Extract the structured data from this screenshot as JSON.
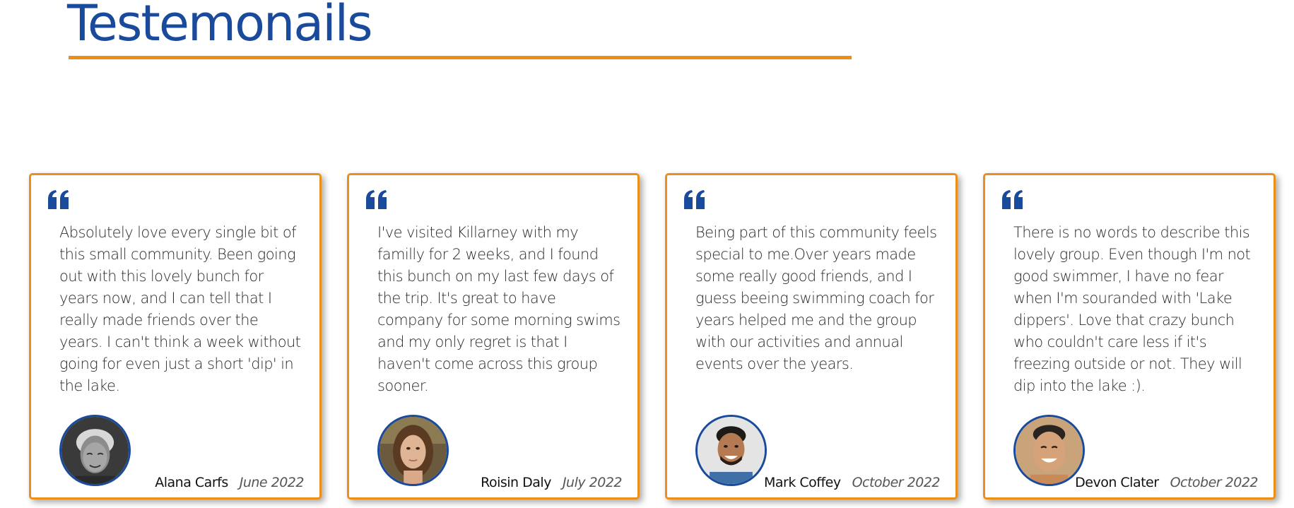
{
  "section": {
    "title": "Testemonails",
    "accent_color": "#e98f1a",
    "title_color": "#1a4a9c"
  },
  "testimonials": [
    {
      "text": "Absolutely love every single bit of this small community. Been going out with this lovely bunch for years now, and I can tell that I really made friends over the years. I can't think a week without going for even just a short 'dip' in the lake.",
      "author": "Alana Carfs",
      "date": "June 2022",
      "icon": "quote-icon",
      "avatar": "avatar-elderly-woman"
    },
    {
      "text": "I've visited Killarney with my familly for 2 weeks, and I found this bunch on my last few days of the trip. It's great to have company for some morning swims and my only regret is that I haven't come across this group sooner.",
      "author": "Roisin Daly",
      "date": "July 2022",
      "icon": "quote-icon",
      "avatar": "avatar-young-woman"
    },
    {
      "text": "Being part of this community feels special to me.Over years made some really good friends, and I guess beeing swimming coach for years helped me and the group with our activities and annual events over the years.",
      "author": "Mark Coffey",
      "date": "October 2022",
      "icon": "quote-icon",
      "avatar": "avatar-smiling-man"
    },
    {
      "text": "There is no words to describe this lovely group. Even though I'm not good swimmer, I have no fear when I'm souranded with 'Lake dippers'. Love that crazy bunch who couldn't care less if it's freezing outside or not. They will dip into the lake :).",
      "author": "Devon Clater",
      "date": "October 2022",
      "icon": "quote-icon",
      "avatar": "avatar-laughing-man"
    }
  ]
}
